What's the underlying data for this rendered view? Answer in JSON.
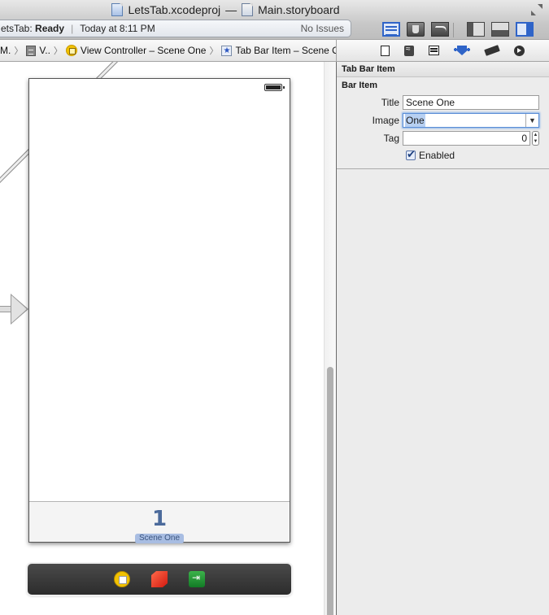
{
  "window": {
    "project_file": "LetsTab.xcodeproj",
    "separator": "—",
    "document_file": "Main.storyboard"
  },
  "status": {
    "project_prefix": "etsTab: ",
    "state": "Ready",
    "timestamp": "Today at 8:11 PM",
    "issues": "No Issues"
  },
  "toolbar": {
    "editor_buttons": [
      "standard-editor",
      "assistant-editor",
      "version-editor"
    ],
    "view_buttons": [
      "navigator",
      "debug-area",
      "utilities"
    ],
    "active_editor": "standard-editor",
    "active_views": [
      "utilities"
    ]
  },
  "breadcrumb": {
    "items": [
      {
        "label": "M.",
        "icon": "none"
      },
      {
        "label": "V..",
        "icon": "storyboard-icon"
      },
      {
        "label": "View Controller – Scene One",
        "icon": "view-controller-icon"
      },
      {
        "label": "Tab Bar Item – Scene One",
        "icon": "tab-bar-item-icon"
      }
    ],
    "separator": "〉"
  },
  "inspector_tabs": [
    "file-inspector",
    "quick-help",
    "identity-inspector",
    "attributes-inspector",
    "size-inspector",
    "connections-inspector"
  ],
  "inspector": {
    "header": "Tab Bar Item",
    "section_title": "Bar Item",
    "fields": {
      "title_label": "Title",
      "title_value": "Scene One",
      "image_label": "Image",
      "image_value": "One",
      "tag_label": "Tag",
      "tag_value": "0",
      "enabled_label": "Enabled",
      "enabled_checked": true
    },
    "dropdown_arrow": "▼",
    "stepper_up": "▲",
    "stepper_down": "▼"
  },
  "canvas": {
    "tab_glyph": "1",
    "tab_label": "Scene One",
    "dock_icons": [
      "view-controller-icon",
      "first-responder-icon",
      "exit-icon"
    ]
  },
  "colors": {
    "accent": "#2f64c8",
    "tab_item_text": "#4b6a9b",
    "tab_label_bg": "#a8bde2",
    "vc_yellow": "#f2c200",
    "first_responder_red": "#d21a10",
    "exit_green": "#127b26"
  }
}
